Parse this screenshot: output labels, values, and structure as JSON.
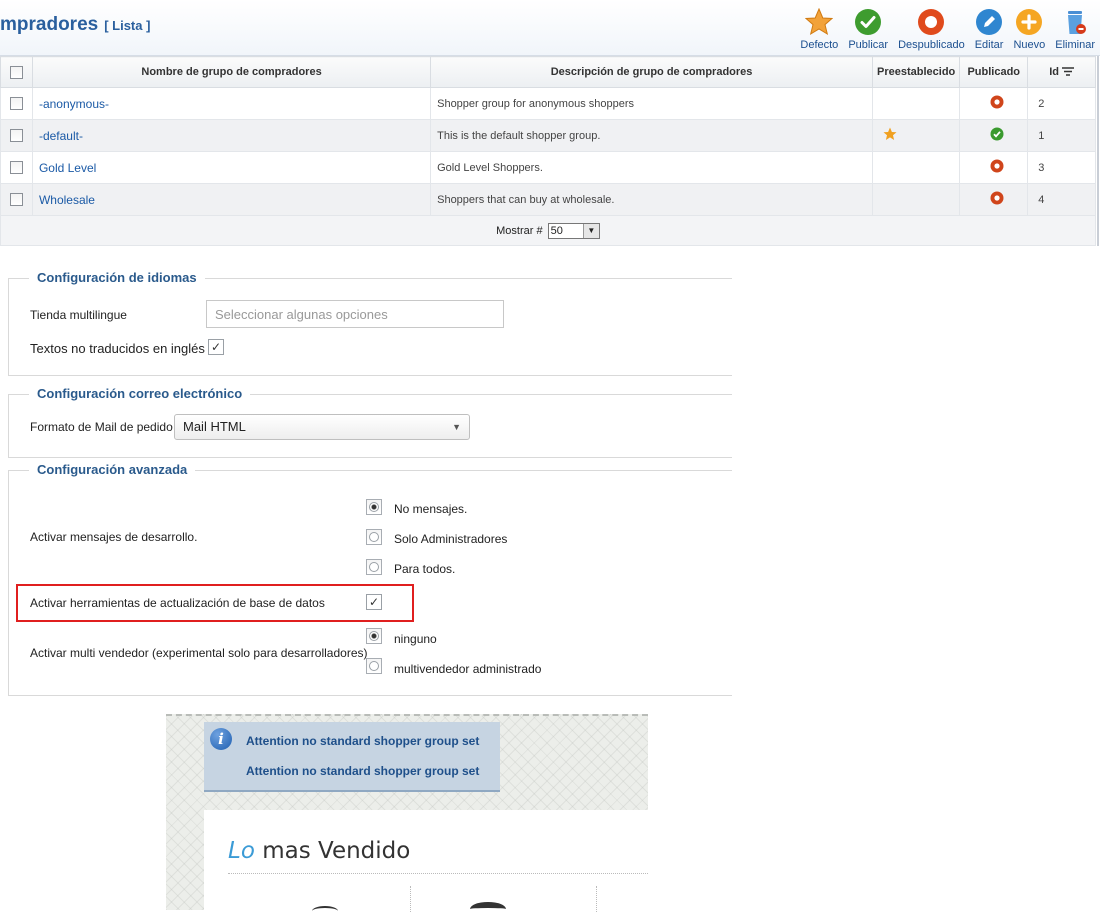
{
  "header": {
    "title": "mpradores",
    "subtitle": "[ Lista ]",
    "toolbar": [
      {
        "id": "defecto",
        "label": "Defecto",
        "icon": "star-icon"
      },
      {
        "id": "publicar",
        "label": "Publicar",
        "icon": "check-circle-icon"
      },
      {
        "id": "despublicado",
        "label": "Despublicado",
        "icon": "unpublish-circle-icon"
      },
      {
        "id": "editar",
        "label": "Editar",
        "icon": "pencil-icon"
      },
      {
        "id": "nuevo",
        "label": "Nuevo",
        "icon": "plus-circle-icon"
      },
      {
        "id": "eliminar",
        "label": "Eliminar",
        "icon": "trash-icon"
      }
    ]
  },
  "table": {
    "columns": [
      "Nombre de grupo de compradores",
      "Descripción de grupo de compradores",
      "Preestablecido",
      "Publicado",
      "Id"
    ],
    "rows": [
      {
        "name": "-anonymous-",
        "description": "Shopper group for anonymous shoppers",
        "default": false,
        "published": false,
        "id": "2"
      },
      {
        "name": "-default-",
        "description": "This is the default shopper group.",
        "default": true,
        "published": true,
        "id": "1"
      },
      {
        "name": "Gold Level",
        "description": "Gold Level Shoppers.",
        "default": false,
        "published": false,
        "id": "3"
      },
      {
        "name": "Wholesale",
        "description": "Shoppers that can buy at wholesale.",
        "default": false,
        "published": false,
        "id": "4"
      }
    ],
    "footer": {
      "label": "Mostrar #",
      "value": "50"
    }
  },
  "config": {
    "languages": {
      "legend": "Configuración de idiomas",
      "multilingual_label": "Tienda multilingue",
      "multilingual_placeholder": "Seleccionar algunas opciones",
      "untranslated_label": "Textos no traducidos en inglés",
      "untranslated_checked": true
    },
    "email": {
      "legend": "Configuración correo electrónico",
      "format_label": "Formato de Mail de pedido",
      "format_value": "Mail HTML"
    },
    "advanced": {
      "legend": "Configuración avanzada",
      "dev_label": "Activar mensajes de desarrollo.",
      "dev_options": [
        "No mensajes.",
        "Solo Administradores",
        "Para todos."
      ],
      "dev_selected": 0,
      "db_tools_label": "Activar herramientas de actualización de base de datos",
      "db_tools_checked": true,
      "multivendor_label": "Activar multi vendedor (experimental solo para desarrolladores)",
      "multivendor_options": [
        "ninguno",
        "multivendedor administrado"
      ],
      "multivendor_selected": 0
    }
  },
  "storefront": {
    "messages": [
      "Attention no standard shopper group set",
      "Attention no standard shopper group set"
    ],
    "best_sellers_accent": "Lo",
    "best_sellers_rest": " mas Vendido"
  },
  "colors": {
    "link": "#1b5aa6",
    "title": "#2a5f9e",
    "published": "#3a9a2e",
    "unpublished": "#d0451b",
    "default_star": "#f0a020",
    "highlight": "#e01f1f"
  }
}
